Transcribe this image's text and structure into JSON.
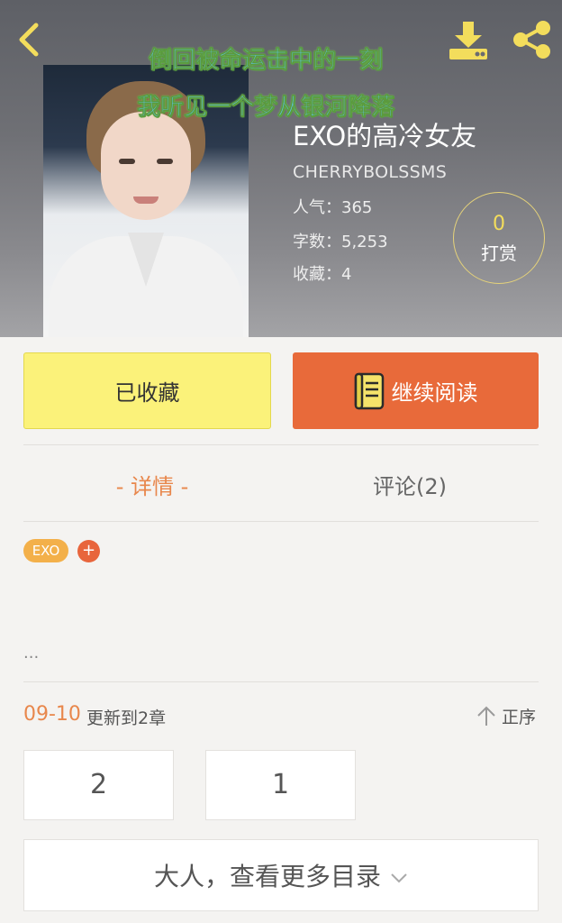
{
  "header": {
    "overlay_line1": "倒回被命运击中的一刻",
    "overlay_line2": "我听见一个梦从银河降落",
    "title": "EXO的高冷女友",
    "author": "CHERRYBOLSSMS",
    "stats": {
      "popularity": "人气：365",
      "word_count": "字数：5,253",
      "favorites": "收藏：4"
    },
    "tip": {
      "count": "0",
      "label": "打赏"
    }
  },
  "actions": {
    "favorite_label": "已收藏",
    "continue_label": "继续阅读"
  },
  "tabs": {
    "detail": "- 详情 -",
    "comments": "评论(2)"
  },
  "tags": {
    "items": [
      "EXO"
    ],
    "add": "+"
  },
  "description": "...",
  "update": {
    "date": "09-10",
    "text": "更新到2章",
    "order_label": "正序"
  },
  "chapters": [
    "2",
    "1"
  ],
  "more_label": "大人，查看更多目录",
  "colors": {
    "accent_orange": "#e86a3a",
    "accent_yellow": "#fbf27a",
    "tab_active": "#e8874c",
    "tag_exo": "#f3b04a"
  },
  "icons": [
    "back-icon",
    "download-icon",
    "share-icon",
    "book-icon",
    "up-arrow-icon",
    "chevron-down-icon"
  ]
}
